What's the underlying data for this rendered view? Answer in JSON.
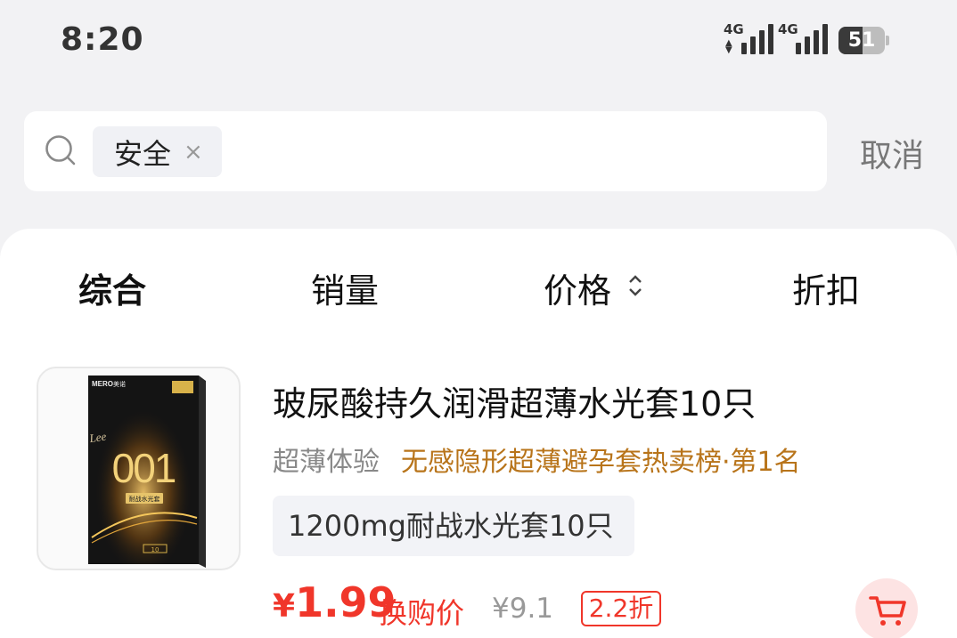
{
  "status_bar": {
    "time": "8:20",
    "network1": "4G",
    "network2": "4G",
    "battery_level": "51",
    "battery_fraction": 0.51
  },
  "search": {
    "chip_label": "安全",
    "chip_close": "×",
    "cancel_label": "取消"
  },
  "sort_tabs": {
    "comprehensive": "综合",
    "sales": "销量",
    "price": "价格",
    "discount": "折扣"
  },
  "product": {
    "title": "玻尿酸持久润滑超薄水光套10只",
    "tag": "超薄体验",
    "rank": "无感隐形超薄避孕套热卖榜·第1名",
    "spec": "1200mg耐战水光套10只",
    "price_currency": "¥",
    "price_value": "1.99",
    "price_label": "换购价",
    "original_price": "¥9.1",
    "discount": "2.2折",
    "image_text": {
      "brand": "MERO",
      "brand_cn": "美诺",
      "side": "Lee",
      "number": "001",
      "product": "耐战水光套",
      "count": "10"
    }
  },
  "colors": {
    "accent_red": "#f0362a",
    "rank_gold": "#b8741a",
    "background": "#f2f2f4"
  }
}
